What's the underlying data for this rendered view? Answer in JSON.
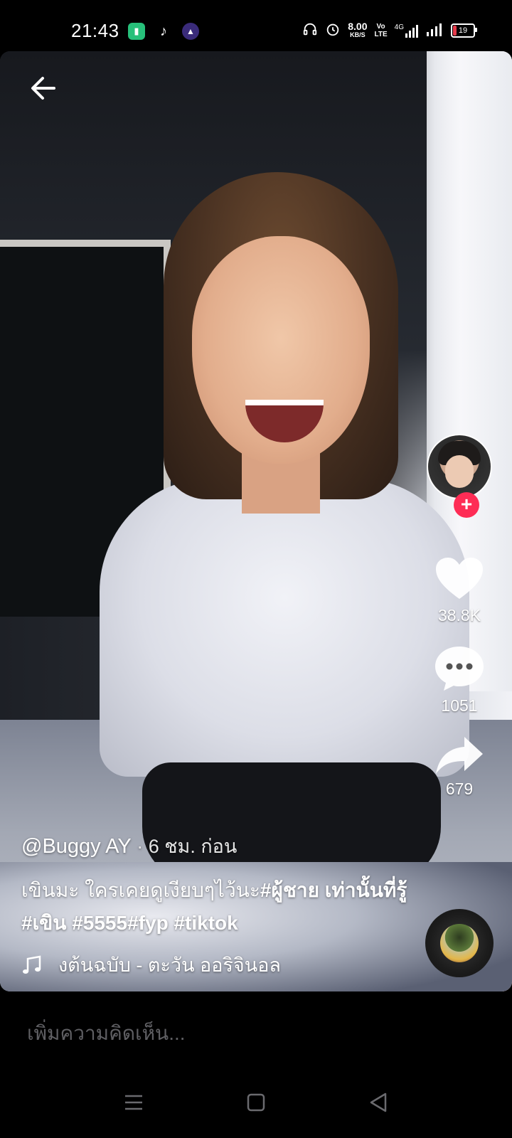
{
  "status_bar": {
    "time": "21:43",
    "network_speed_value": "8.00",
    "network_speed_unit": "KB/S",
    "volte": "Vo\nLTE",
    "network_type": "4G",
    "battery_level": "19"
  },
  "video": {
    "author_handle": "@Buggy AY",
    "posted_time": "· 6 ชม. ก่อน",
    "description_text": "เขินมะ ใครเคยดูเงียบๆไว้นะ",
    "hashtags": [
      "#ผู้ชาย เท่านั้นที่รู้",
      "#เขิน",
      "#5555",
      "#fyp",
      "#tiktok"
    ],
    "music_title": "งต้นฉบับ - ตะวัน ออริจินอล",
    "likes": "38.8K",
    "comments": "1051",
    "shares": "679"
  },
  "comment_bar": {
    "placeholder": "เพิ่มความคิดเห็น..."
  },
  "colors": {
    "follow_plus": "#fe2c55",
    "background": "#000000",
    "battery_low": "#e53a4a"
  },
  "icons": [
    "back-arrow-icon",
    "heart-icon",
    "comment-icon",
    "share-icon",
    "music-note-icon",
    "plus-icon",
    "nav-menu-icon",
    "nav-home-icon",
    "nav-back-icon"
  ]
}
